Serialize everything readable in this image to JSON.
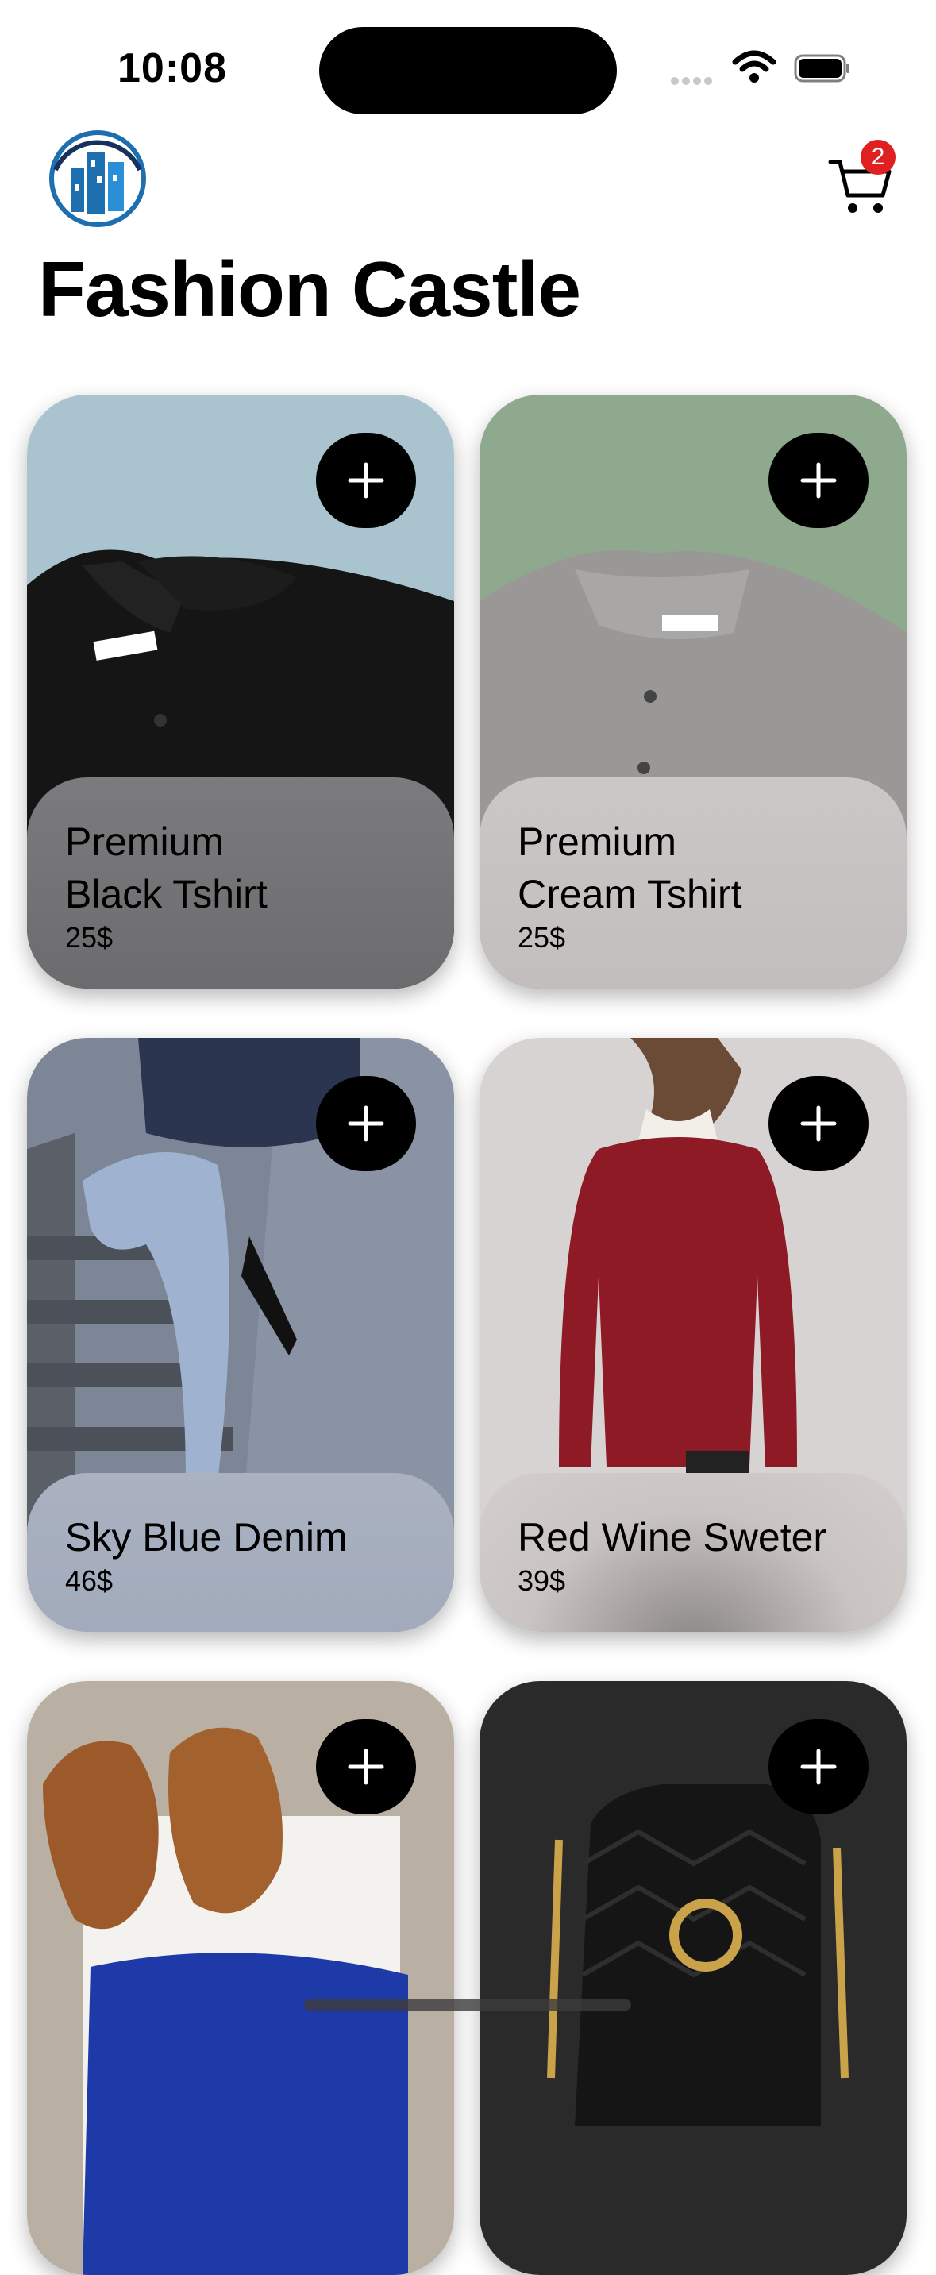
{
  "status_bar": {
    "time": "10:08"
  },
  "header": {
    "cart_count": "2",
    "title": "Fashion Castle"
  },
  "products": [
    {
      "name": "Premium\nBlack Tshirt",
      "price": "25$",
      "bg": "#a9c3cf"
    },
    {
      "name": "Premium\nCream Tshirt",
      "price": "25$",
      "bg": "#8ea98d"
    },
    {
      "name": "Sky Blue Denim",
      "price": "46$",
      "bg": "#7f8fa6"
    },
    {
      "name": "Red Wine Sweter",
      "price": "39$",
      "bg": "#d8d3d3"
    },
    {
      "name": "",
      "price": "",
      "bg": "#b9afa3"
    },
    {
      "name": "",
      "price": "",
      "bg": "#2a2a2a"
    }
  ],
  "colors": {
    "accent": "#000000",
    "badge": "#e02020"
  },
  "icons": [
    "castle-logo-icon",
    "cart-icon",
    "plus-icon",
    "wifi-icon",
    "battery-icon",
    "signal-icon"
  ]
}
